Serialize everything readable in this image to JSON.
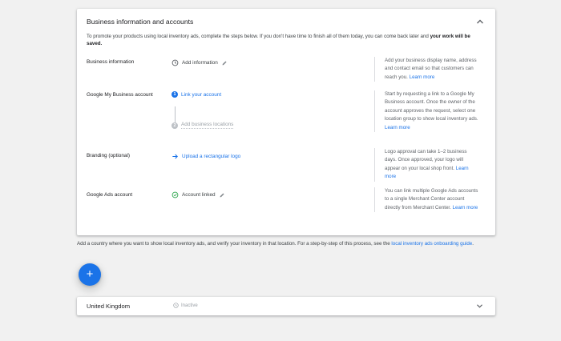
{
  "section": {
    "title": "Business information and accounts",
    "intro_prefix": "To promote your products using local inventory ads, complete the steps below. If you don't have time to finish all of them today, you can come back later and ",
    "intro_bold": "your work will be saved."
  },
  "rows": {
    "business_info": {
      "label": "Business information",
      "action": "Add information",
      "help": "Add your business display name, address and contact email so that customers can reach you. ",
      "help_link": "Learn more"
    },
    "gmb": {
      "label": "Google My Business account",
      "step1_number": "1",
      "step1": "Link your account",
      "step2_number": "2",
      "step2": "Add business locations",
      "help": "Start by requesting a link to a Google My Business account. Once the owner of the account approves the request, select one location group to show local inventory ads. ",
      "help_link": "Learn more"
    },
    "branding": {
      "label": "Branding (optional)",
      "action": "Upload a rectangular logo",
      "help": "Logo approval can take 1–2 business days. Once approved, your logo will appear on your local shop front. ",
      "help_link": "Learn more"
    },
    "google_ads": {
      "label": "Google Ads account",
      "action": "Account linked",
      "help": "You can link multiple Google Ads accounts to a single Merchant Center account directly from Merchant Center. ",
      "help_link": "Learn more"
    }
  },
  "country_hint": {
    "text": "Add a country where you want to show local inventory ads, and verify your inventory in that location. For a step-by-step of this process, see the ",
    "link": "local inventory ads onboarding guide",
    "suffix": "."
  },
  "fab_label": "+",
  "country": {
    "name": "United Kingdom",
    "status": "Inactive"
  },
  "colors": {
    "accent": "#1a73e8",
    "success": "#34a853",
    "muted": "#9aa0a6"
  }
}
